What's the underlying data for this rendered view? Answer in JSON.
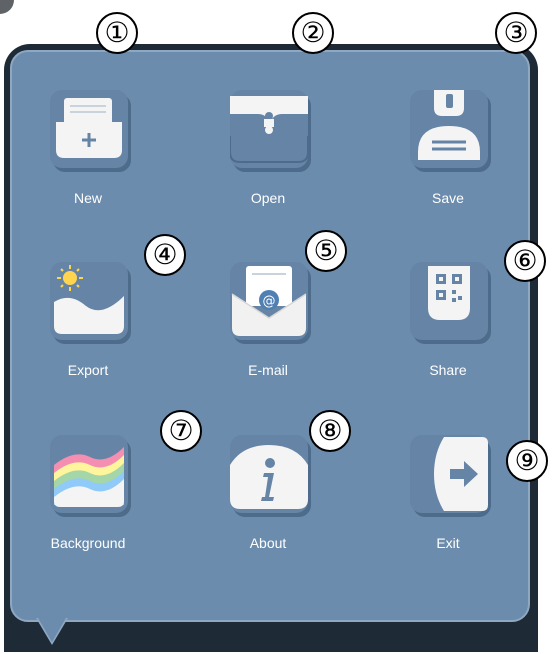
{
  "callouts": [
    "①",
    "②",
    "③",
    "④",
    "⑤",
    "⑥",
    "⑦",
    "⑧",
    "⑨"
  ],
  "menu": {
    "items": [
      {
        "label": "New",
        "icon": "new-document-icon"
      },
      {
        "label": "Open",
        "icon": "open-folder-icon"
      },
      {
        "label": "Save",
        "icon": "save-floppy-icon"
      },
      {
        "label": "Export",
        "icon": "export-image-icon"
      },
      {
        "label": "E-mail",
        "icon": "email-envelope-icon"
      },
      {
        "label": "Share",
        "icon": "share-qr-code-icon"
      },
      {
        "label": "Background",
        "icon": "background-rainbow-icon"
      },
      {
        "label": "About",
        "icon": "about-info-icon"
      },
      {
        "label": "Exit",
        "icon": "exit-arrow-icon"
      }
    ]
  },
  "colors": {
    "menu_background": "#6b8cad",
    "tile": "#6685a6",
    "icon_fill": "#f4f4f4",
    "label": "#ffffff"
  }
}
